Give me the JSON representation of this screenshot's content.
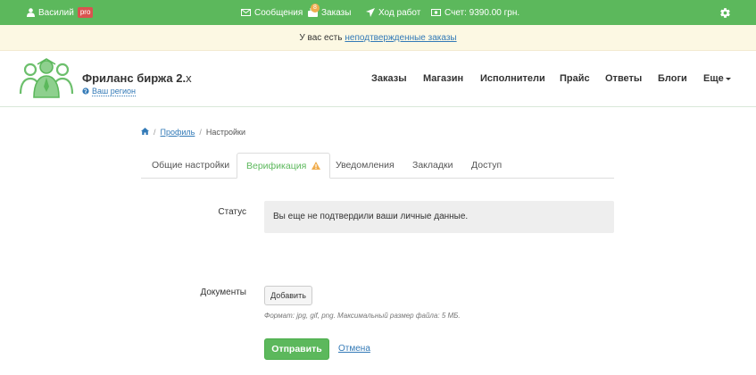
{
  "topbar": {
    "user_name": "Василий",
    "pro_badge": "pro",
    "messages": "Сообщения",
    "orders": "Заказы",
    "orders_count": "8",
    "progress": "Ход работ",
    "balance": "Счет: 9390.00 грн.",
    "icons": [
      "user-icon",
      "envelope-icon",
      "orders-icon",
      "rocket-icon",
      "money-icon",
      "gear-icon"
    ]
  },
  "notice": {
    "text": "У вас есть",
    "link": "неподтвержденные заказы"
  },
  "header": {
    "brand": "Фриланс биржа 2.",
    "brand_suffix": "x",
    "region": "Ваш регион",
    "nav": [
      {
        "label": "Заказы"
      },
      {
        "label": "Магазин"
      },
      {
        "label": "Исполнители"
      },
      {
        "label": "Прайс"
      },
      {
        "label": "Ответы"
      },
      {
        "label": "Блоги"
      },
      {
        "label": "Еще"
      }
    ]
  },
  "breadcrumb": {
    "items": [
      "Профиль",
      "Настройки"
    ]
  },
  "tabs": [
    {
      "label": "Общие настройки"
    },
    {
      "label": "Верификация"
    },
    {
      "label": "Уведомления"
    },
    {
      "label": "Закладки"
    },
    {
      "label": "Доступ"
    }
  ],
  "form": {
    "status_label": "Статус",
    "status_text": "Вы еще не подтвердили ваши личные данные.",
    "documents_label": "Документы",
    "add_button": "Добавить",
    "hint": "Формат: jpg, gif, png. Максимальный размер файла: 5 МБ.",
    "submit": "Отправить",
    "cancel": "Отмена"
  },
  "colors": {
    "brand_green": "#5cb85c",
    "notice_bg": "#fcf8e3",
    "link": "#337ab7",
    "warning": "#f0ad4e",
    "pro_red": "#d9534f"
  }
}
